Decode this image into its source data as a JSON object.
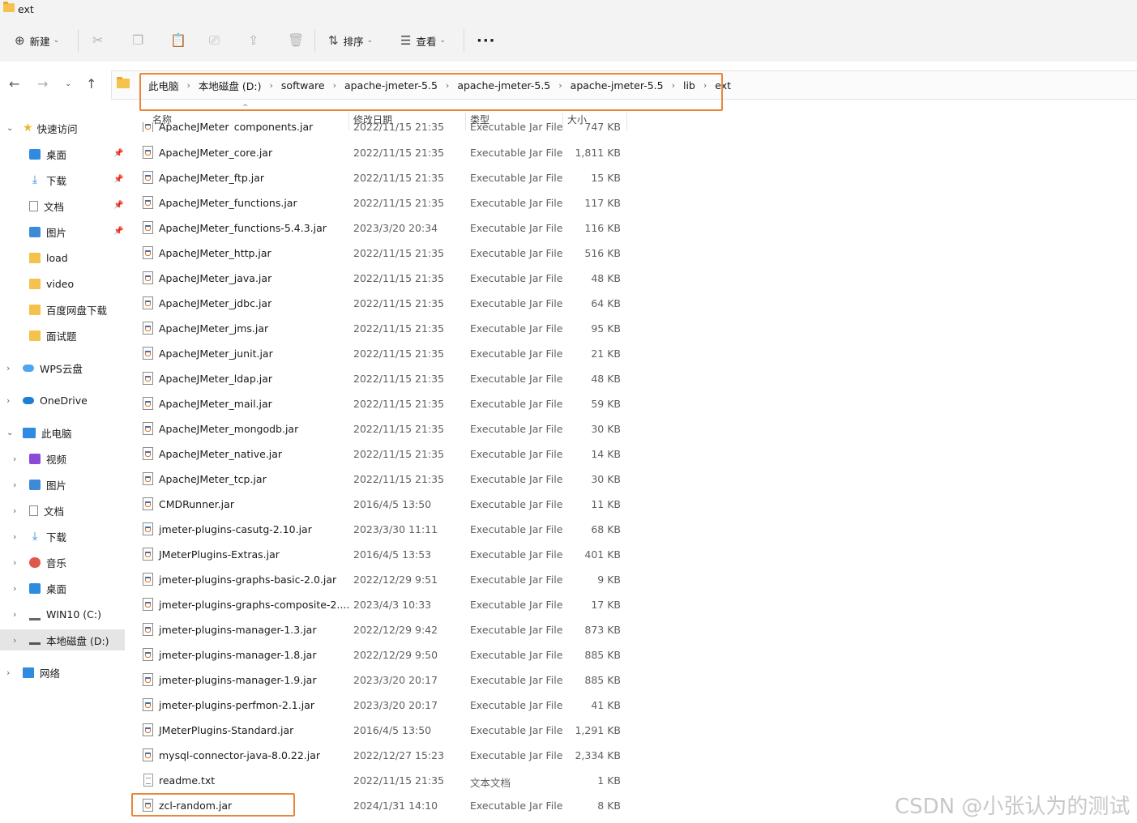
{
  "window": {
    "title": "ext"
  },
  "toolbar": {
    "new_label": "新建",
    "sort_label": "排序",
    "view_label": "查看",
    "more_icon": "more-icon"
  },
  "address": {
    "crumbs": [
      "此电脑",
      "本地磁盘 (D:)",
      "software",
      "apache-jmeter-5.5",
      "apache-jmeter-5.5",
      "apache-jmeter-5.5",
      "lib",
      "ext"
    ]
  },
  "sidebar": {
    "quick_access": "快速访问",
    "quick_items": [
      "桌面",
      "下载",
      "文档",
      "图片",
      "load",
      "video",
      "百度网盘下载",
      "面试题"
    ],
    "wps": "WPS云盘",
    "onedrive": "OneDrive",
    "this_pc": "此电脑",
    "pc_items": [
      "视频",
      "图片",
      "文档",
      "下载",
      "音乐",
      "桌面",
      "WIN10 (C:)",
      "本地磁盘 (D:)"
    ],
    "network": "网络"
  },
  "columns": {
    "name": "名称",
    "modified": "修改日期",
    "type": "类型",
    "size": "大小"
  },
  "partial_row": {
    "name": "ApacheJMeter_components.jar",
    "date": "2022/11/15 21:35",
    "type": "Executable Jar File",
    "size": "747 KB"
  },
  "files": [
    {
      "name": "ApacheJMeter_core.jar",
      "date": "2022/11/15 21:35",
      "type": "Executable Jar File",
      "size": "1,811 KB"
    },
    {
      "name": "ApacheJMeter_ftp.jar",
      "date": "2022/11/15 21:35",
      "type": "Executable Jar File",
      "size": "15 KB"
    },
    {
      "name": "ApacheJMeter_functions.jar",
      "date": "2022/11/15 21:35",
      "type": "Executable Jar File",
      "size": "117 KB"
    },
    {
      "name": "ApacheJMeter_functions-5.4.3.jar",
      "date": "2023/3/20 20:34",
      "type": "Executable Jar File",
      "size": "116 KB"
    },
    {
      "name": "ApacheJMeter_http.jar",
      "date": "2022/11/15 21:35",
      "type": "Executable Jar File",
      "size": "516 KB"
    },
    {
      "name": "ApacheJMeter_java.jar",
      "date": "2022/11/15 21:35",
      "type": "Executable Jar File",
      "size": "48 KB"
    },
    {
      "name": "ApacheJMeter_jdbc.jar",
      "date": "2022/11/15 21:35",
      "type": "Executable Jar File",
      "size": "64 KB"
    },
    {
      "name": "ApacheJMeter_jms.jar",
      "date": "2022/11/15 21:35",
      "type": "Executable Jar File",
      "size": "95 KB"
    },
    {
      "name": "ApacheJMeter_junit.jar",
      "date": "2022/11/15 21:35",
      "type": "Executable Jar File",
      "size": "21 KB"
    },
    {
      "name": "ApacheJMeter_ldap.jar",
      "date": "2022/11/15 21:35",
      "type": "Executable Jar File",
      "size": "48 KB"
    },
    {
      "name": "ApacheJMeter_mail.jar",
      "date": "2022/11/15 21:35",
      "type": "Executable Jar File",
      "size": "59 KB"
    },
    {
      "name": "ApacheJMeter_mongodb.jar",
      "date": "2022/11/15 21:35",
      "type": "Executable Jar File",
      "size": "30 KB"
    },
    {
      "name": "ApacheJMeter_native.jar",
      "date": "2022/11/15 21:35",
      "type": "Executable Jar File",
      "size": "14 KB"
    },
    {
      "name": "ApacheJMeter_tcp.jar",
      "date": "2022/11/15 21:35",
      "type": "Executable Jar File",
      "size": "30 KB"
    },
    {
      "name": "CMDRunner.jar",
      "date": "2016/4/5 13:50",
      "type": "Executable Jar File",
      "size": "11 KB"
    },
    {
      "name": "jmeter-plugins-casutg-2.10.jar",
      "date": "2023/3/30 11:11",
      "type": "Executable Jar File",
      "size": "68 KB"
    },
    {
      "name": "JMeterPlugins-Extras.jar",
      "date": "2016/4/5 13:53",
      "type": "Executable Jar File",
      "size": "401 KB"
    },
    {
      "name": "jmeter-plugins-graphs-basic-2.0.jar",
      "date": "2022/12/29 9:51",
      "type": "Executable Jar File",
      "size": "9 KB"
    },
    {
      "name": "jmeter-plugins-graphs-composite-2....",
      "date": "2023/4/3 10:33",
      "type": "Executable Jar File",
      "size": "17 KB"
    },
    {
      "name": "jmeter-plugins-manager-1.3.jar",
      "date": "2022/12/29 9:42",
      "type": "Executable Jar File",
      "size": "873 KB"
    },
    {
      "name": "jmeter-plugins-manager-1.8.jar",
      "date": "2022/12/29 9:50",
      "type": "Executable Jar File",
      "size": "885 KB"
    },
    {
      "name": "jmeter-plugins-manager-1.9.jar",
      "date": "2023/3/20 20:17",
      "type": "Executable Jar File",
      "size": "885 KB"
    },
    {
      "name": "jmeter-plugins-perfmon-2.1.jar",
      "date": "2023/3/20 20:17",
      "type": "Executable Jar File",
      "size": "41 KB"
    },
    {
      "name": "JMeterPlugins-Standard.jar",
      "date": "2016/4/5 13:50",
      "type": "Executable Jar File",
      "size": "1,291 KB"
    },
    {
      "name": "mysql-connector-java-8.0.22.jar",
      "date": "2022/12/27 15:23",
      "type": "Executable Jar File",
      "size": "2,334 KB"
    },
    {
      "name": "readme.txt",
      "date": "2022/11/15 21:35",
      "type": "文本文档",
      "size": "1 KB",
      "icon": "text-file-icon"
    },
    {
      "name": "zcl-random.jar",
      "date": "2024/1/31 14:10",
      "type": "Executable Jar File",
      "size": "8 KB"
    }
  ],
  "watermark": "CSDN @小张认为的测试",
  "colors": {
    "highlight": "#e8863b",
    "selection": "#e5e5e5",
    "folder": "#f4c24d"
  }
}
